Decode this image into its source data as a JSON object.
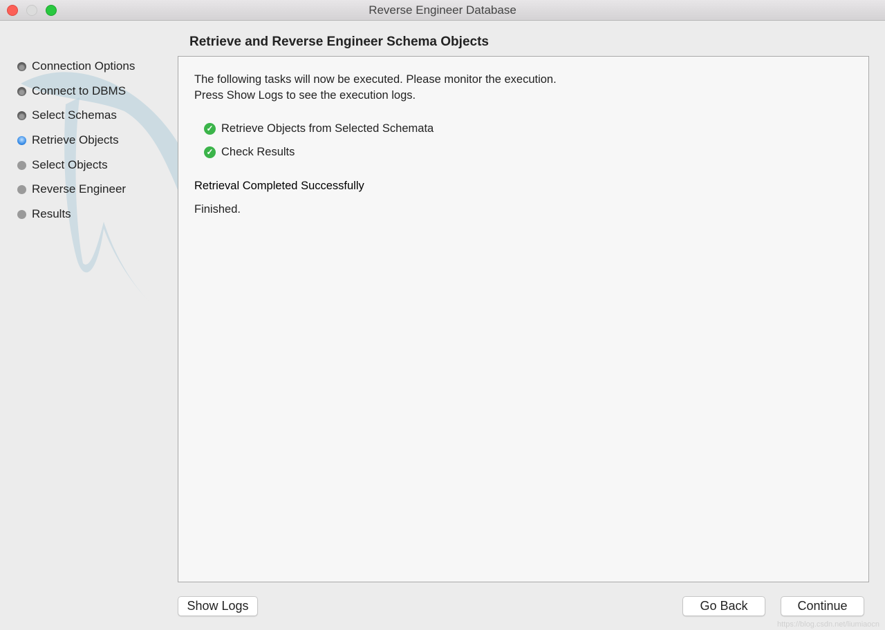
{
  "window": {
    "title": "Reverse Engineer Database"
  },
  "sidebar": {
    "steps": [
      {
        "label": "Connection Options",
        "state": "done"
      },
      {
        "label": "Connect to DBMS",
        "state": "done"
      },
      {
        "label": "Select Schemas",
        "state": "done"
      },
      {
        "label": "Retrieve Objects",
        "state": "active"
      },
      {
        "label": "Select Objects",
        "state": "todo"
      },
      {
        "label": "Reverse Engineer",
        "state": "todo"
      },
      {
        "label": "Results",
        "state": "todo"
      }
    ]
  },
  "main": {
    "title": "Retrieve and Reverse Engineer Schema Objects",
    "intro1": "The following tasks will now be executed. Please monitor the execution.",
    "intro2": "Press Show Logs to see the execution logs.",
    "tasks": [
      {
        "label": "Retrieve Objects from Selected Schemata",
        "status": "completed"
      },
      {
        "label": "Check Results",
        "status": "completed"
      }
    ],
    "status": "Retrieval Completed Successfully",
    "finished": "Finished."
  },
  "buttons": {
    "show_logs": "Show Logs",
    "go_back": "Go Back",
    "continue": "Continue"
  },
  "watermark": "https://blog.csdn.net/liumiaocn",
  "colors": {
    "check": "#3bb44a",
    "active_step": "#3a8ee8"
  }
}
